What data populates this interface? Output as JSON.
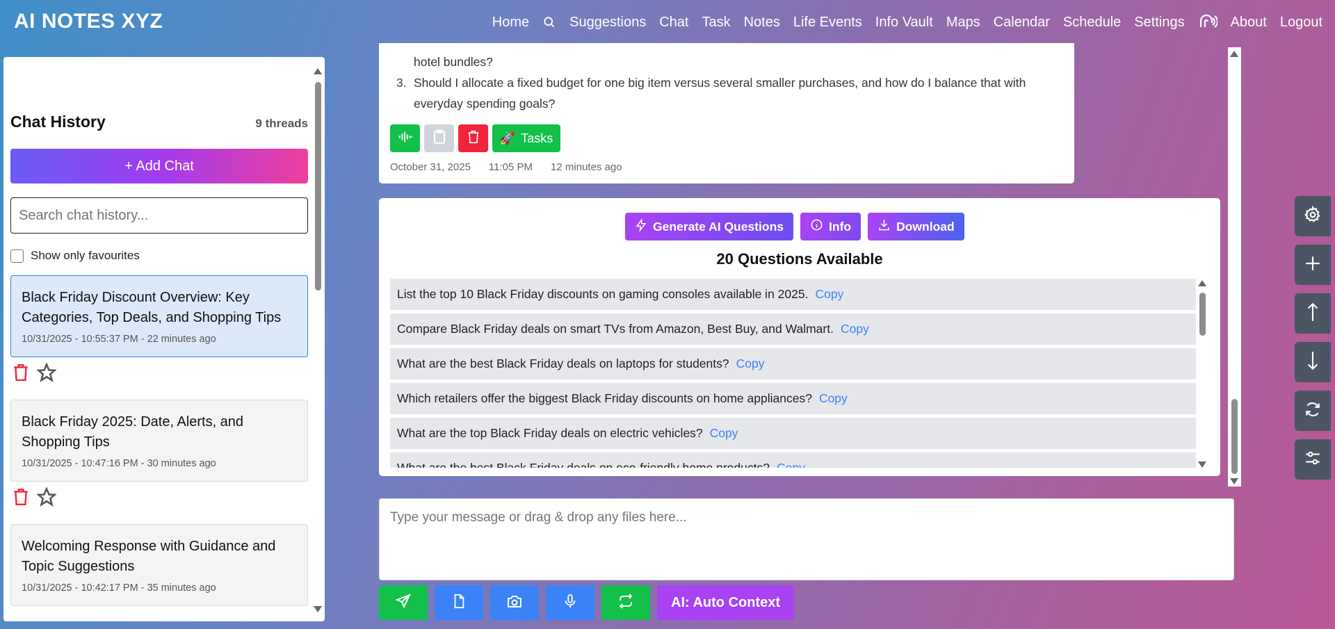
{
  "app": {
    "brand": "AI NOTES XYZ"
  },
  "nav": {
    "items": [
      "Home",
      "Suggestions",
      "Chat",
      "Task",
      "Notes",
      "Life Events",
      "Info Vault",
      "Maps",
      "Calendar",
      "Schedule",
      "Settings",
      "About",
      "Logout"
    ],
    "icons": [
      "search-icon",
      "voice-assistant-icon"
    ]
  },
  "sidebar": {
    "title": "Chat History",
    "count": "9 threads",
    "add_chat": "+ Add Chat",
    "search_placeholder": "Search chat history...",
    "favourites_label": "Show only favourites",
    "threads": [
      {
        "title": "Black Friday Discount Overview: Key Categories, Top Deals, and Shopping Tips",
        "meta": "10/31/2025 - 10:55:37 PM - 22 minutes ago",
        "active": true
      },
      {
        "title": "Black Friday 2025: Date, Alerts, and Shopping Tips",
        "meta": "10/31/2025 - 10:47:16 PM - 30 minutes ago",
        "active": false
      },
      {
        "title": "Welcoming Response with Guidance and Topic Suggestions",
        "meta": "10/31/2025 - 10:42:17 PM - 35 minutes ago",
        "active": false
      }
    ]
  },
  "message": {
    "items": [
      {
        "num": "",
        "text": "hotel bundles?"
      },
      {
        "num": "3.",
        "text": "Should I allocate a fixed budget for one big item versus several smaller purchases, and how do I balance that with"
      },
      {
        "num": "",
        "text": "everyday spending goals?"
      }
    ],
    "tasks_label": "Tasks",
    "date": "October 31, 2025",
    "time": "11:05 PM",
    "ago": "12 minutes ago"
  },
  "questions": {
    "generate_label": "Generate AI Questions",
    "info_label": "Info",
    "download_label": "Download",
    "heading": "20 Questions Available",
    "copy_label": "Copy",
    "items": [
      "List the top 10 Black Friday discounts on gaming consoles available in 2025.",
      "Compare Black Friday deals on smart TVs from Amazon, Best Buy, and Walmart.",
      "What are the best Black Friday deals on laptops for students?",
      "Which retailers offer the biggest Black Friday discounts on home appliances?",
      "What are the top Black Friday deals on electric vehicles?",
      "What are the best Black Friday deals on eco-friendly home products?"
    ]
  },
  "composer": {
    "placeholder": "Type your message or drag & drop any files here...",
    "ai_label": "AI: Auto Context"
  },
  "colors": {
    "green": "#12c04a",
    "blue": "#3b82f6",
    "purple": "#a942f2",
    "red": "#f0243a",
    "float_bg": "#4b5563"
  }
}
